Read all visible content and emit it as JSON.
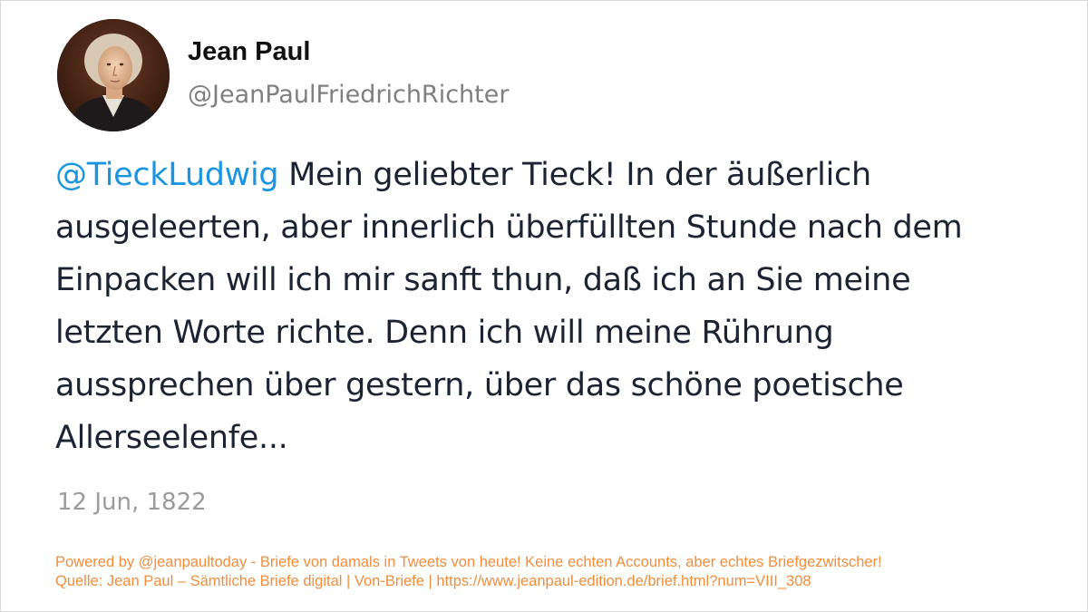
{
  "author": {
    "display_name": "Jean Paul",
    "handle": "@JeanPaulFriedrichRichter"
  },
  "tweet": {
    "mention": "@TieckLudwig",
    "lines": [
      " Mein geliebter Tieck! In der äußerlich",
      "ausgeleerten, aber innerlich überfüllten Stunde nach dem",
      "Einpacken will ich mir sanft thun, daß ich an Sie meine",
      "letzten Worte richte. Denn ich will meine Rührung",
      "aussprechen über gestern, über das schöne poetische",
      "Allerseelenfe..."
    ],
    "date": "12 Jun, 1822"
  },
  "footer": {
    "line1": "Powered by @jeanpaultoday - Briefe von damals in Tweets von heute! Keine echten Accounts, aber echtes Briefgezwitscher!",
    "line2": "Quelle: Jean Paul – Sämtliche Briefe digital | Von-Briefe | https://www.jeanpaul-edition.de/brief.html?num=VIII_308"
  },
  "colors": {
    "mention": "#1b95e0",
    "text": "#1c2333",
    "muted": "#9b9b9b",
    "footer": "#f28d3c"
  },
  "icons": {
    "avatar": "portrait-avatar"
  }
}
